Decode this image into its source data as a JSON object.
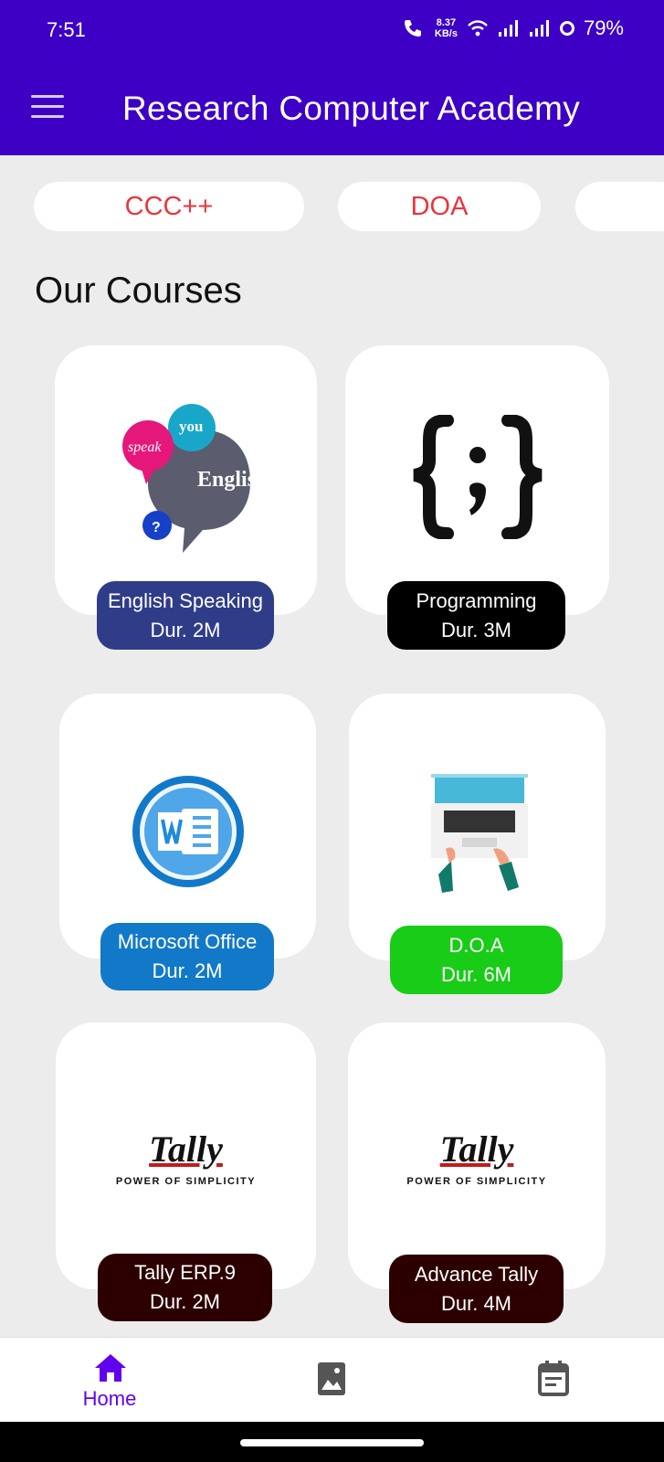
{
  "status_bar": {
    "time": "7:51",
    "speed_value": "8.37",
    "speed_unit": "KB/s",
    "battery": "79%"
  },
  "app_bar": {
    "title": "Research Computer Academy",
    "menu_icon": "hamburger-menu-icon"
  },
  "chips": [
    "CCC++",
    "DOA",
    ""
  ],
  "section_title": "Our Courses",
  "courses": [
    {
      "name": "English Speaking",
      "duration": "Dur. 2M",
      "color": "#2f3d89",
      "icon": "english-speech-bubbles-icon"
    },
    {
      "name": "Programming",
      "duration": "Dur. 3M",
      "color": "#000000",
      "icon": "code-braces-icon"
    },
    {
      "name": "Microsoft Office",
      "duration": "Dur. 2M",
      "color": "#1279c9",
      "icon": "word-icon"
    },
    {
      "name": "D.O.A",
      "duration": "Dur. 6M",
      "color": "#18cc17",
      "icon": "laptop-typing-icon"
    },
    {
      "name": "Tally ERP.9",
      "duration": "Dur. 2M",
      "color": "#2d0000",
      "icon": "tally-logo"
    },
    {
      "name": "Advance Tally",
      "duration": "Dur. 4M",
      "color": "#2d0000",
      "icon": "tally-logo"
    }
  ],
  "tally_tagline": "POWER OF SIMPLICITY",
  "tally_wordmark": "Tally",
  "english_logo_text": {
    "speak": "speak",
    "you": "you",
    "english": "English",
    "question": "?"
  },
  "bottom_nav": [
    {
      "label": "Home",
      "icon": "home-icon",
      "active": true
    },
    {
      "label": "",
      "icon": "image-icon",
      "active": false
    },
    {
      "label": "",
      "icon": "calendar-icon",
      "active": false
    }
  ],
  "colors": {
    "app_bar": "#3d00c4",
    "chip_text": "#e8363c",
    "nav_active": "#6200ee"
  }
}
